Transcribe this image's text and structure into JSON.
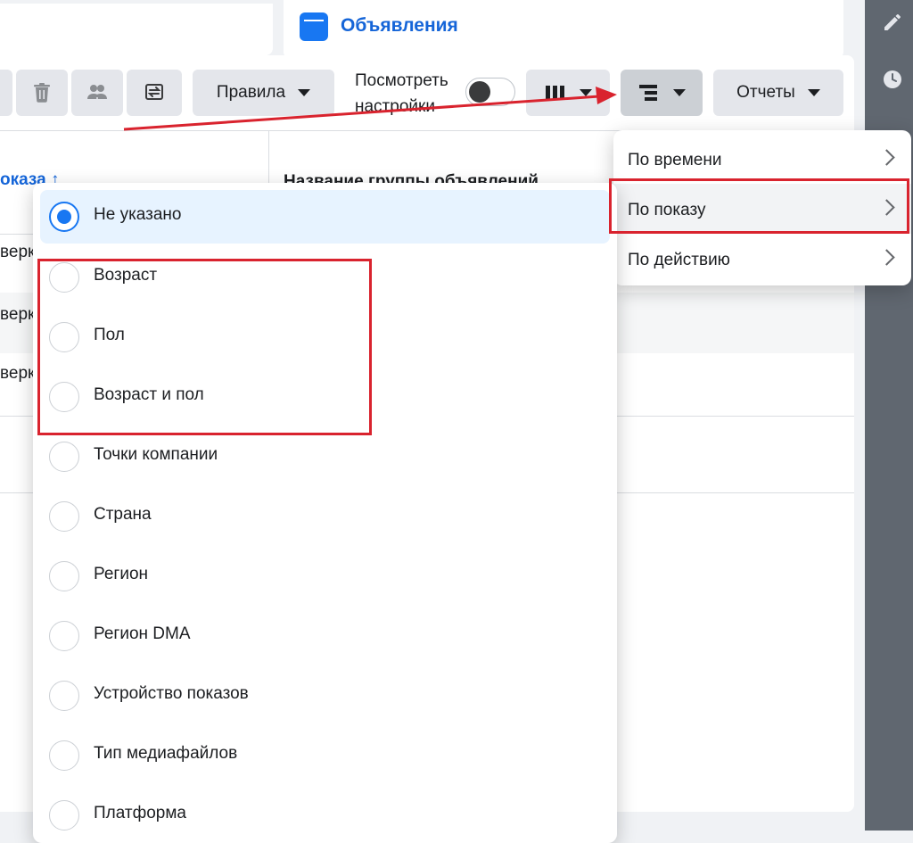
{
  "tabs": {
    "ads_title": "Объявления"
  },
  "toolbar": {
    "rules_label": "Правила",
    "view_settings_line1": "Посмотреть",
    "view_settings_line2": "настройки",
    "reports_label": "Отчеты"
  },
  "table": {
    "header_left": "оказа ↑",
    "header_right": "Название группы объявлений",
    "row_texts": [
      "верк",
      "верк",
      "верк"
    ]
  },
  "breakdown_menu": {
    "items": [
      {
        "label": "По времени"
      },
      {
        "label": "По показу"
      },
      {
        "label": "По действию"
      }
    ],
    "highlighted": "По показу"
  },
  "delivery_options": {
    "selected": "Не указано",
    "items": [
      {
        "label": "Не указано"
      },
      {
        "label": "Возраст"
      },
      {
        "label": "Пол"
      },
      {
        "label": "Возраст и пол"
      },
      {
        "label": "Точки компании"
      },
      {
        "label": "Страна"
      },
      {
        "label": "Регион"
      },
      {
        "label": "Регион DMA"
      },
      {
        "label": "Устройство показов"
      },
      {
        "label": "Тип медиафайлов"
      },
      {
        "label": "Платформа"
      }
    ]
  },
  "icons": {
    "delete": "trash-icon",
    "audience": "people-icon",
    "compare": "swap-icon",
    "columns": "columns-icon",
    "breakdown": "breakdown-icon",
    "edit": "pencil-icon",
    "history": "clock-icon"
  },
  "colors": {
    "accent": "#1877f2",
    "annotation": "#d9232e"
  }
}
